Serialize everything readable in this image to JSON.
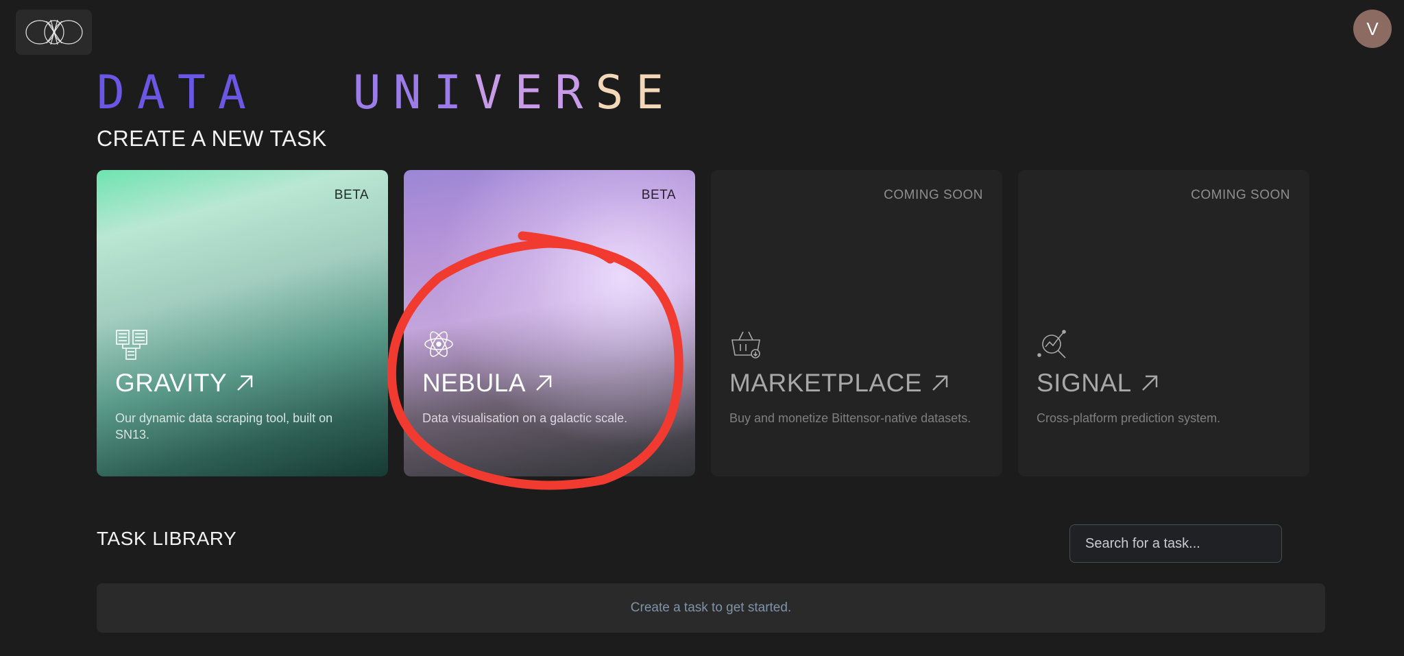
{
  "header": {
    "logo_icon": "infinity-loops-logo",
    "avatar_initial": "V",
    "avatar_color": "#8b6b62"
  },
  "brand": {
    "word1_part1": "DATA",
    "word2_part1": "UNI",
    "word2_part2": "VER",
    "word2_part3": "SE",
    "gradient_colors": [
      "#6a57e4",
      "#9b7ce8",
      "#c89be8",
      "#e9c4d8",
      "#f2d8b9"
    ]
  },
  "create_section": {
    "title": "CREATE A NEW TASK",
    "cards": [
      {
        "tag": "BETA",
        "title": "GRAVITY",
        "description": "Our dynamic data scraping tool, built on SN13.",
        "icon": "data-table-icon"
      },
      {
        "tag": "BETA",
        "title": "NEBULA",
        "description": "Data visualisation on a galactic scale.",
        "icon": "atom-icon"
      },
      {
        "tag": "COMING SOON",
        "title": "MARKETPLACE",
        "description": "Buy and monetize Bittensor-native datasets.",
        "icon": "basket-icon"
      },
      {
        "tag": "COMING SOON",
        "title": "SIGNAL",
        "description": "Cross-platform prediction system.",
        "icon": "magnifier-chart-icon"
      }
    ]
  },
  "library": {
    "title": "TASK LIBRARY",
    "search_placeholder": "Search for a task...",
    "empty_message": "Create a task to get started."
  },
  "annotation_color": "#f23b30"
}
